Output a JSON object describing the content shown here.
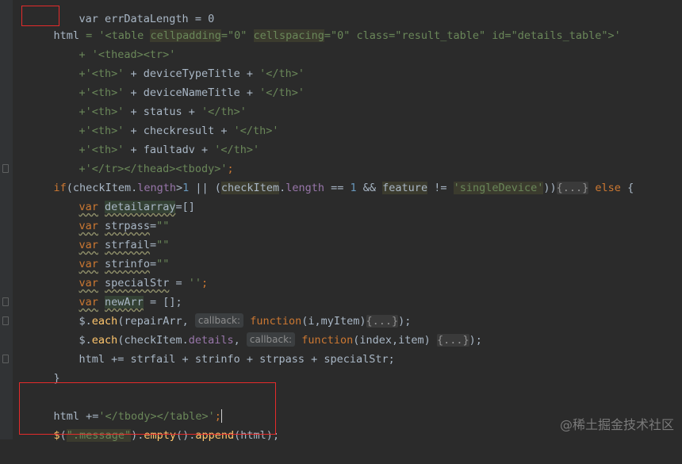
{
  "code": {
    "line0": "var errDataLength = 0",
    "l1": {
      "html": "html",
      "eq": " = '",
      "open": "<table ",
      "cp": "cellpadding",
      "a1": "=\"0\" ",
      "cs": "cellspacing",
      "a2": "=\"0\" class=\"result_table\" id=\"details_table\">'"
    },
    "l2": {
      "text": "+ '<thead><tr>'"
    },
    "l3": {
      "a": "+'<th>'",
      "b": " + deviceTypeTitle + ",
      "c": "'</th>'"
    },
    "l4": {
      "a": "+'<th>'",
      "b": " + deviceNameTitle + ",
      "c": "'</th>'"
    },
    "l5": {
      "a": "+'<th>'",
      "b": " + status + ",
      "c": "'</th>'"
    },
    "l6": {
      "a": "+'<th>'",
      "b": " + checkresult + ",
      "c": "'</th>'"
    },
    "l7": {
      "a": "+'<th>'",
      "b": " + faultadv + ",
      "c": "'</th>'"
    },
    "l8": {
      "a": "+'</tr></thead><tbody>'",
      "b": ";"
    },
    "l9": {
      "if": "if",
      "p1": "(",
      "ci": "checkItem",
      "dot": ".",
      "len": "length",
      "gt": ">",
      "one": "1",
      "or": " || (",
      "ci2": "checkItem",
      "dot2": ".",
      "len2": "length",
      "eq2": " == ",
      "one2": "1",
      "and": " && ",
      "feat": "feature",
      "ne": " != ",
      "sd": "'singleDevice'",
      "close": "))",
      "ph": "{...}",
      "else": " else",
      "brace": " {"
    },
    "l10": {
      "var": "var",
      "name": "detailarray",
      "rest": "=[]"
    },
    "l11": {
      "var": "var",
      "name": "strpass",
      "eq": "=",
      "val": "\"\""
    },
    "l12": {
      "var": "var",
      "name": "strfail",
      "eq": "=",
      "val": "\"\""
    },
    "l13": {
      "var": "var",
      "name": "strinfo",
      "eq": "=",
      "val": "\"\""
    },
    "l14": {
      "var": "var",
      "name": "specialStr",
      "eq": " = ",
      "val": "''",
      "semi": ";"
    },
    "l15": {
      "var": "var",
      "name": "newArr",
      "rest": " = [];"
    },
    "l16": {
      "dollar": "$",
      "dot": ".",
      "each": "each",
      "args": "(repairArr,",
      "hint": "callback:",
      "func": "function",
      "params": "(i,myItem)",
      "ph": "{...}",
      "end": ");"
    },
    "l17": {
      "dollar": "$",
      "dot": ".",
      "each": "each",
      "p": "(checkItem.",
      "det": "details",
      "comma": ",",
      "hint": "callback:",
      "func": "function",
      "params": "(index,item) ",
      "ph": "{...}",
      "end": ");"
    },
    "l18": {
      "text": "html += strfail + strinfo + strpass + specialStr;"
    },
    "l19": {
      "text": "}"
    },
    "l20": {
      "a": "html +=",
      "b": "'</tbody></table>'",
      "c": ";"
    },
    "l21": {
      "dollar": "$",
      "p1": "(",
      "sel": "\".message\"",
      "p2": ")",
      "dot": ".",
      "empty": "empty",
      "mid": "().",
      "append": "append",
      "end": "(html);"
    }
  },
  "watermark": "@稀土掘金技术社区"
}
